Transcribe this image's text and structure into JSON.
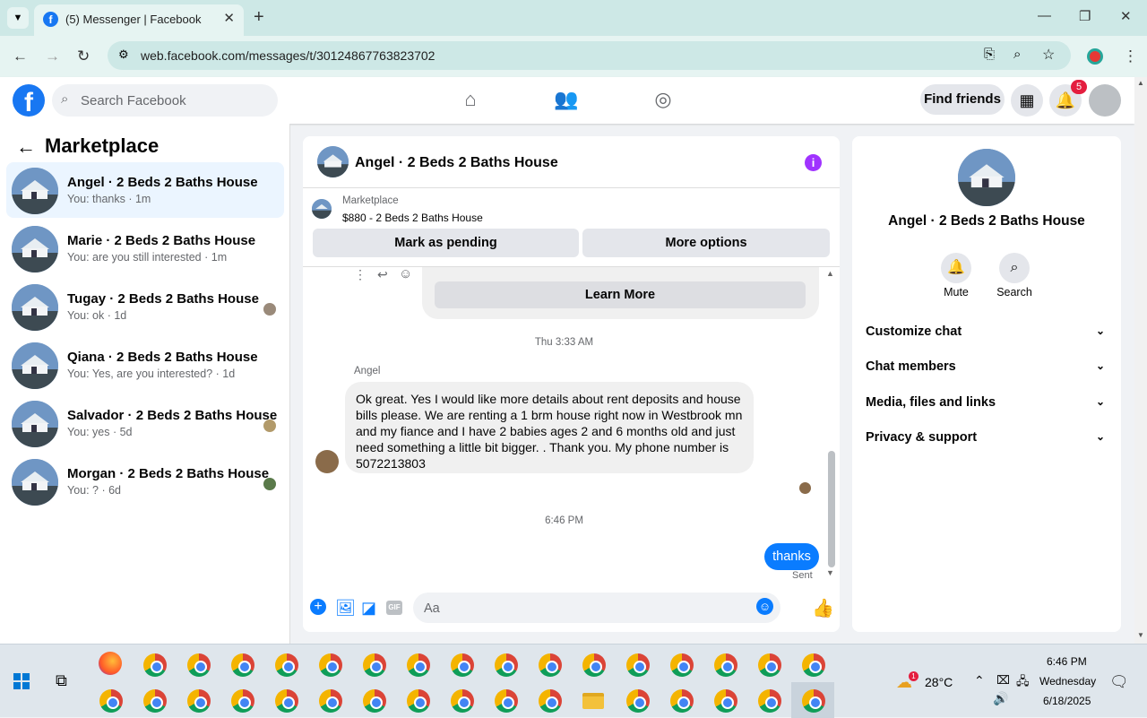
{
  "browser": {
    "tab_title": "(5) Messenger | Facebook",
    "url": "web.facebook.com/messages/t/30124867763823702",
    "tab_favicon_letter": "f"
  },
  "fb_header": {
    "search_placeholder": "Search Facebook",
    "find_friends": "Find friends",
    "notification_count": "5"
  },
  "left_panel": {
    "title": "Marketplace",
    "conversations": [
      {
        "name": "Angel · 2 Beds 2 Baths House",
        "preview": "You: thanks · 1m",
        "selected": true
      },
      {
        "name": "Marie · 2 Beds 2 Baths House",
        "preview": "You: are you still interested · 1m"
      },
      {
        "name": "Tugay · 2 Beds 2 Baths House",
        "preview": "You: ok · 1d"
      },
      {
        "name": "Qiana · 2 Beds 2 Baths House",
        "preview": "You: Yes, are you interested? · 1d"
      },
      {
        "name": "Salvador · 2 Beds 2 Baths House",
        "preview": "You: yes · 5d"
      },
      {
        "name": "Morgan · 2 Beds 2 Baths House",
        "preview": "You: ? · 6d"
      }
    ]
  },
  "chat": {
    "title": "Angel · 2 Beds 2 Baths House",
    "marketplace_label": "Marketplace",
    "listing": "$880 - 2 Beds 2 Baths House",
    "mark_pending": "Mark as pending",
    "more_options": "More options",
    "learn_more": "Learn More",
    "timestamp1": "Thu 3:33 AM",
    "sender_name": "Angel",
    "incoming_message": "Ok great. Yes I would like more details about rent deposits and house bills please. We are renting a 1 brm house right now in Westbrook mn and my fiance and I have 2 babies ages 2 and 6 months old and just need something a little bit bigger. . Thank you. My phone number is 5072213803",
    "timestamp2": "6:46 PM",
    "outgoing_message": "thanks",
    "sent_status": "Sent",
    "compose_placeholder": "Aa",
    "gif_label": "GIF"
  },
  "right_panel": {
    "name": "Angel · 2 Beds 2 Baths House",
    "mute": "Mute",
    "search": "Search",
    "sections": [
      "Customize chat",
      "Chat members",
      "Media, files and links",
      "Privacy & support"
    ]
  },
  "taskbar": {
    "temperature": "28°C",
    "weather_badge": "1",
    "time": "6:46 PM",
    "day": "Wednesday",
    "date": "6/18/2025"
  }
}
